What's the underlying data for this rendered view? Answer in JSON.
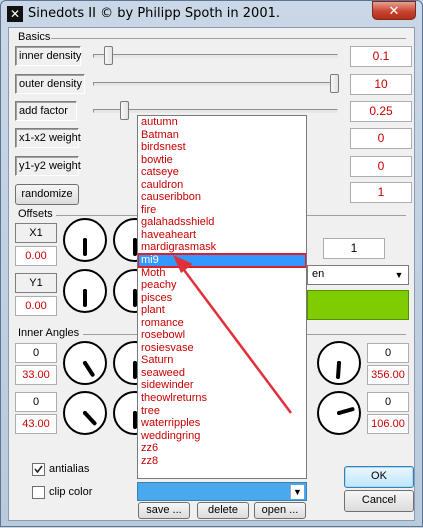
{
  "window": {
    "title": "Sinedots II © by Philipp Spoth in 2001.",
    "close": "✕",
    "icon": "app-logo-icon"
  },
  "basics": {
    "label": "Basics",
    "params": [
      {
        "label": "inner density",
        "value": "0.1",
        "slider": 0.03
      },
      {
        "label": "outer density",
        "value": "10",
        "slider": 1.0
      },
      {
        "label": "add factor",
        "value": "0.25",
        "slider": 0.1
      },
      {
        "label": "x1-x2 weight",
        "value": "0"
      },
      {
        "label": "y1-y2 weight",
        "value": "0"
      }
    ],
    "randomize_label": "randomize",
    "randomize_value": "1"
  },
  "offsets": {
    "label": "Offsets",
    "x1_label": "X1",
    "x1_value": "0.00",
    "y1_label": "Y1",
    "y1_value": "0.00",
    "extra_value": "1",
    "combo_partial": "en"
  },
  "inner_angles": {
    "label": "Inner Angles",
    "left": [
      {
        "top": "0",
        "bottom": "33.00"
      },
      {
        "top": "0",
        "bottom": "43.00"
      }
    ],
    "right": [
      {
        "top": "0",
        "bottom": "356.00"
      },
      {
        "top": "0",
        "bottom": "106.00"
      }
    ]
  },
  "options": {
    "antialias": "antialias",
    "antialias_checked": true,
    "clip_color": "clip color",
    "clip_checked": false
  },
  "preset_list": {
    "items": [
      "autumn",
      "Batman",
      "birdsnest",
      "bowtie",
      "catseye",
      "cauldron",
      "causeribbon",
      "fire",
      "galahadsshield",
      "haveaheart",
      "mardigrasmask",
      "mi9",
      "Moth",
      "peachy",
      "pisces",
      "plant",
      "romance",
      "rosebowl",
      "rosiesvase",
      "Saturn",
      "seaweed",
      "sidewinder",
      "theowlreturns",
      "tree",
      "waterripples",
      "weddingring",
      "zz6",
      "zz8"
    ],
    "selected_index": 11,
    "combo_value": ""
  },
  "buttons": {
    "save": "save ...",
    "delete": "delete",
    "open": "open ...",
    "ok": "OK",
    "cancel": "Cancel"
  },
  "colors": {
    "accent_red": "#c80000",
    "selection": "#3399ff",
    "swatch": "#7fcc00"
  }
}
